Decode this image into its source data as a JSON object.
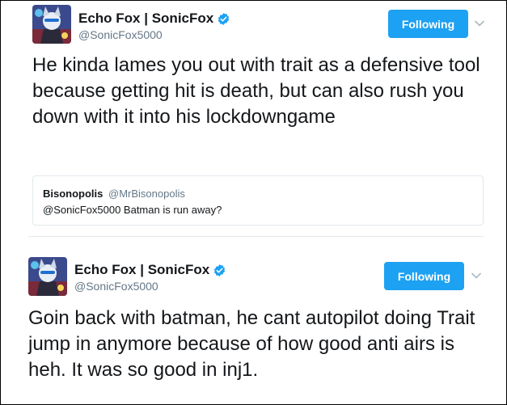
{
  "tweets": [
    {
      "author_name": "Echo Fox | SonicFox",
      "author_handle": "@SonicFox5000",
      "follow_button_label": "Following",
      "text": "He kinda lames you out with trait as a defensive tool because getting hit is death, but can also rush you down with it into his lockdowngame",
      "quoted_tweet": {
        "author_name": "Bisonopolis",
        "author_handle": "@MrBisonopolis",
        "text": "@SonicFox5000 Batman is run away?"
      }
    },
    {
      "author_name": "Echo Fox | SonicFox",
      "author_handle": "@SonicFox5000",
      "follow_button_label": "Following",
      "text": "Goin back with batman, he cant autopilot doing Trait jump in anymore because of how good anti airs is heh. It was so good in inj1."
    }
  ],
  "icons": {
    "verified": "verified-badge-icon",
    "caret": "chevron-down-icon"
  },
  "colors": {
    "accent": "#1da1f2",
    "secondary_text": "#657786",
    "border": "#e1e8ed"
  }
}
